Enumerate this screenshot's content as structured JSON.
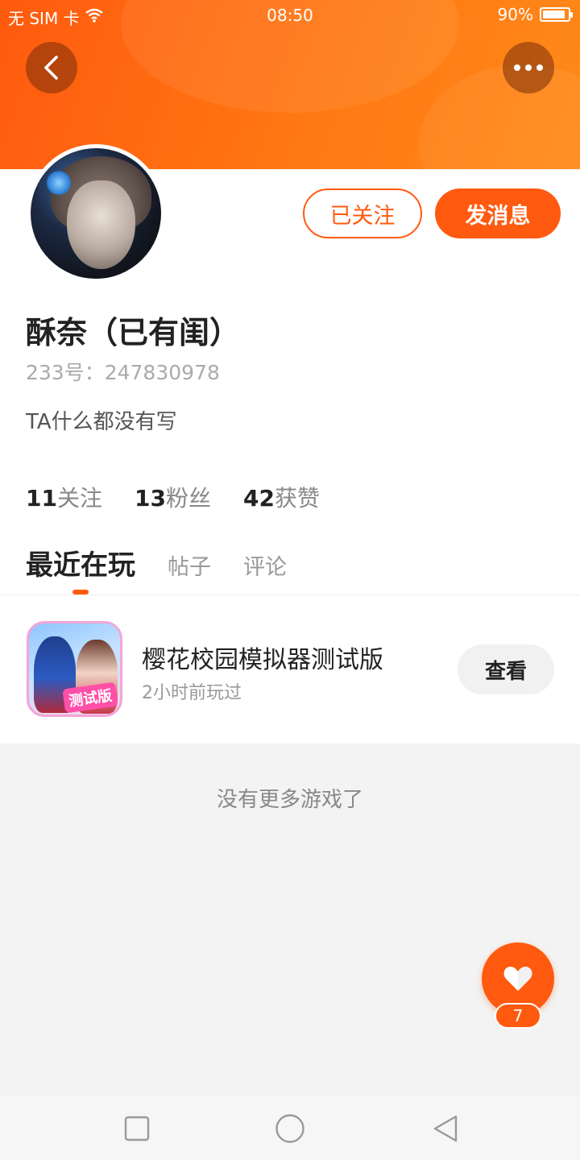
{
  "status_bar": {
    "carrier": "无 SIM 卡",
    "time": "08:50",
    "battery": "90%",
    "battery_level": 0.9
  },
  "header": {
    "back_icon": "chevron-left-icon",
    "more_icon": "more-dots-icon"
  },
  "profile": {
    "follow_label": "已关注",
    "message_label": "发消息",
    "username": "酥奈（已有闺）",
    "uid": "233号：247830978",
    "bio": "TA什么都没有写",
    "stats": [
      {
        "num": "11",
        "label": "关注"
      },
      {
        "num": "13",
        "label": "粉丝"
      },
      {
        "num": "42",
        "label": "获赞"
      }
    ]
  },
  "tabs": [
    {
      "label": "最近在玩",
      "active": true
    },
    {
      "label": "帖子",
      "active": false
    },
    {
      "label": "评论",
      "active": false
    }
  ],
  "game": {
    "title": "樱花校园模拟器测试版",
    "subtitle": "2小时前玩过",
    "icon_badge": "测试版",
    "view_label": "查看"
  },
  "empty_text": "没有更多游戏了",
  "like_fab": {
    "icon": "heart-icon",
    "count": "7"
  },
  "colors": {
    "accent": "#ff5a0f",
    "header_gradient_end": "#ff8a1a"
  }
}
